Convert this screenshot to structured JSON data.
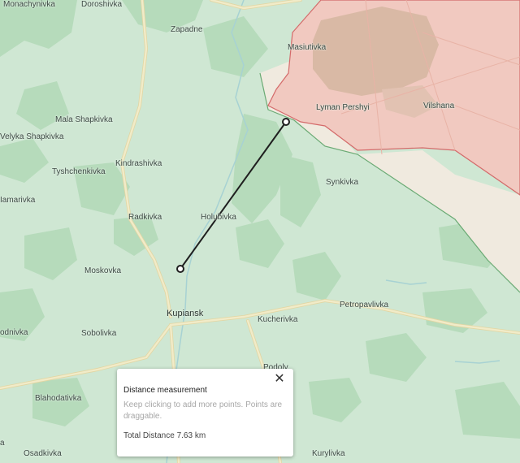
{
  "map": {
    "colors": {
      "land": "#cfe7d3",
      "forest": "#b2d9b8",
      "occupied": "#f1c9c0",
      "occupied_dark": "#d4b3a2",
      "contested": "#f0eadf",
      "frontline": "#d46a6a",
      "road": "#f1ebc8",
      "road_outline": "#e2d6a3",
      "water": "#a7d2d3",
      "measure_line": "#1f1f1f"
    },
    "labels": [
      {
        "key": "monachynivka",
        "text": "Monachynivka"
      },
      {
        "key": "doroshivka",
        "text": "Doroshivka"
      },
      {
        "key": "zapadne",
        "text": "Zapadne"
      },
      {
        "key": "masiutivka",
        "text": "Masiutivka"
      },
      {
        "key": "lyman_pershyi",
        "text": "Lyman Pershyi"
      },
      {
        "key": "vilshana",
        "text": "Vilshana"
      },
      {
        "key": "mala_shapkivka",
        "text": "Mala Shapkivka"
      },
      {
        "key": "velyka_shapkivka",
        "text": "Velyka Shapkivka"
      },
      {
        "key": "kindrashivka",
        "text": "Kindrashivka"
      },
      {
        "key": "tyshchenkivka",
        "text": "Tyshchenkivka"
      },
      {
        "key": "synkivka",
        "text": "Synkivka"
      },
      {
        "key": "iamarivka",
        "text": "Iamarivka"
      },
      {
        "key": "radkivka",
        "text": "Radkivka"
      },
      {
        "key": "holubivka",
        "text": "Holubivka"
      },
      {
        "key": "moskovka",
        "text": "Moskovka"
      },
      {
        "key": "petropavlivka",
        "text": "Petropavlivka"
      },
      {
        "key": "kupiansk",
        "text": "Kupiansk"
      },
      {
        "key": "kucherivka",
        "text": "Kucherivka"
      },
      {
        "key": "sobolivka",
        "text": "Sobolivka"
      },
      {
        "key": "odnivka",
        "text": "odnivka"
      },
      {
        "key": "podoly",
        "text": "Podoly"
      },
      {
        "key": "blahodativka",
        "text": "Blahodativka"
      },
      {
        "key": "osadkivka",
        "text": "Osadkivka"
      },
      {
        "key": "kurylivka",
        "text": "Kurylivka"
      },
      {
        "key": "edge_a",
        "text": "a"
      }
    ]
  },
  "popup": {
    "title": "Distance measurement",
    "hint": "Keep clicking to add more points. Points are draggable.",
    "distance_label": "Total Distance 7.63 km",
    "close_symbol": "✕"
  }
}
